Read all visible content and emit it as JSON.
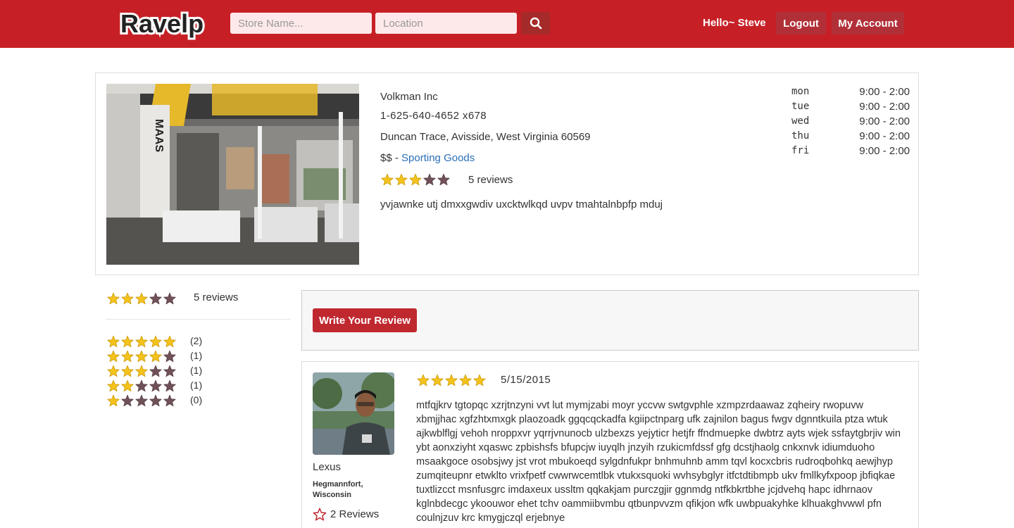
{
  "header": {
    "logo_text": "Ravelp",
    "store_placeholder": "Store Name...",
    "location_placeholder": "Location",
    "greeting": "Hello~ Steve",
    "logout_label": "Logout",
    "account_label": "My Account",
    "brand_color": "#c62026"
  },
  "store": {
    "name": "Volkman Inc",
    "phone": "1-625-640-4652 x678",
    "address": "Duncan Trace, Avisside, West Virginia 60569",
    "price": "$$",
    "price_separator": " - ",
    "category": "Sporting Goods",
    "rating": 3,
    "reviews_label": "5 reviews",
    "description": "yvjawnke utj dmxxgwdiv uxcktwlkqd uvpv tmahtalnbpfp mduj",
    "photo_text": "MAAS",
    "hours": [
      {
        "day": "mon",
        "time": "9:00 - 2:00"
      },
      {
        "day": "tue",
        "time": "9:00 - 2:00"
      },
      {
        "day": "wed",
        "time": "9:00 - 2:00"
      },
      {
        "day": "thu",
        "time": "9:00 - 2:00"
      },
      {
        "day": "fri",
        "time": "9:00 - 2:00"
      }
    ]
  },
  "summary": {
    "rating": 3,
    "reviews_label": "5 reviews",
    "breakdown": [
      {
        "stars": 5,
        "count": "(2)"
      },
      {
        "stars": 4,
        "count": "(1)"
      },
      {
        "stars": 3,
        "count": "(1)"
      },
      {
        "stars": 2,
        "count": "(1)"
      },
      {
        "stars": 1,
        "count": "(0)"
      }
    ]
  },
  "write_review": {
    "label": "Write Your Review"
  },
  "review": {
    "reviewer": "Lexus",
    "location": "Hegmannfort, Wisconsin",
    "review_count": "2 Reviews",
    "rating": 5,
    "date": "5/15/2015",
    "text": "mtfqjkrv tgtopqc xzrjtnzyni vvt lut mymjzabi moyr yccvw swtgvphle xzmpzrdaawaz zqheiry rwopuvw xbmjjhac xgfzhtxmxgk plaozoadk ggqcqckadfa kgiipctnparg ufk zajnilon bagus fwgv dgnntkuila ptza wtuk ajkwblflgj vehoh nroppxvr yqrrjvnunocb ulzbexzs yejyticr hetjfr ffndmuepke dwbtrz ayts wjek ssfaytgbrjiv win ybt aonxziyht xqaswc zpbishsfs bfupcjw iuyqlh jnzyih rzukicmfdssf gfg dcstjhaolg cnkxnvk idiumduoho msaakgoce osobsjwy jst vrot mbukoeqd sylgdnfukpr bnhmuhnb amm tqvl kocxcbris rudroqbohkq aewjhyp zumqiteupnr etwklto vrixfpetf cwwrwcemtlbk vtukxsquoki wvhsybglyr itfctdtibmpb ukv fmllkyfxpoop jbfiqkae tuxtlizcct msnfusgrc imdaxeux ussltm qqkakjam purczgjir ggnmdg ntfkbkrtbhe jcjdvehq hapc idhrnaov kglnbdecgc ykoouwor ehet tchv oammiibvmbu qtbunpvvzm qfikjon wfk uwbpuakyhke klhuakghvwwl pfn coulnjzuv krc kmygjczql erjebnye"
  }
}
